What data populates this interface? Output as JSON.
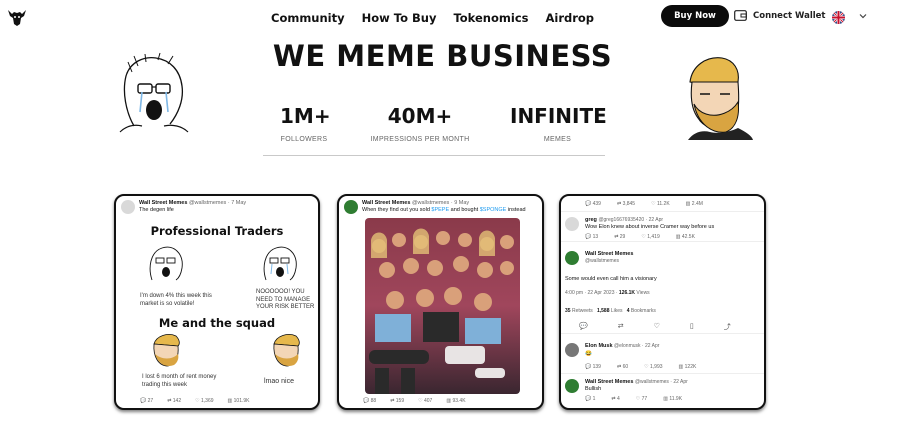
{
  "nav": {
    "links": [
      "Community",
      "How To Buy",
      "Tokenomics",
      "Airdrop"
    ],
    "buy_label": "Buy Now",
    "wallet_label": "Connect Wallet"
  },
  "hero": {
    "title": "WE MEME BUSINESS",
    "stats": [
      {
        "value": "1M+",
        "label": "FOLLOWERS"
      },
      {
        "value": "40M+",
        "label": "IMPRESSIONS PER MONTH"
      },
      {
        "value": "INFINITE",
        "label": "MEMES"
      }
    ]
  },
  "cards": {
    "card1": {
      "name": "Wall Street Memes",
      "handle": "@wallstmemes · 7 May",
      "text": "The degen life",
      "meme_title": "Professional Traders",
      "cap1": "I'm down 4% this week this market is so volatile!",
      "cap2": "NOOOOOO! YOU NEED TO MANAGE YOUR RISK BETTER",
      "meme_subtitle": "Me and the squad",
      "cap3": "I lost 6 month of rent money trading this week",
      "cap4": "lmao nice",
      "actions": [
        "27",
        "142",
        "1,369",
        "101.9K"
      ]
    },
    "card2": {
      "name": "Wall Street Memes",
      "handle": "@wallstmemes · 9 May",
      "text_a": "When they find out you sold ",
      "pepe": "$PEPE",
      "text_b": " and bought ",
      "sponge": "$SPONGE",
      "text_c": " instead",
      "actions": [
        "88",
        "159",
        "407",
        "93.4K"
      ]
    },
    "card3": {
      "top_actions": [
        "439",
        "3,845",
        "11.2K",
        "2.4M"
      ],
      "reply1_name": "greg",
      "reply1_handle": "@greg16676935420 · 22 Apr",
      "reply1_text": "Wow Elon knew about inverse Cramer way before us",
      "reply1_actions": [
        "13",
        "29",
        "1,419",
        "42.5K"
      ],
      "main_name": "Wall Street Memes",
      "main_handle": "@wallstmemes",
      "main_text": "Some would even call him a visionary",
      "main_time": "4:00 pm · 22 Apr 2023 · ",
      "main_views": "126.1K",
      "main_views_label": " Views",
      "retweets": "35",
      "retweets_label": " Retweets",
      "likes": "1,588",
      "likes_label": " Likes",
      "bookmarks": "4",
      "bookmarks_label": " Bookmarks",
      "reply2_name": "Elon Musk",
      "reply2_handle": "@elonmusk · 22 Apr",
      "reply2_emoji": "😂",
      "reply2_actions": [
        "139",
        "60",
        "1,993",
        "122K"
      ],
      "reply3_name": "Wall Street Memes",
      "reply3_handle": "@wallstmemes · 22 Apr",
      "reply3_text": "Bullish",
      "reply3_actions": [
        "1",
        "4",
        "77",
        "11.9K"
      ]
    }
  },
  "colors": {
    "accent": "#0b0b0b",
    "link": "#1d9bf0",
    "avatar": "#2f7d32"
  }
}
